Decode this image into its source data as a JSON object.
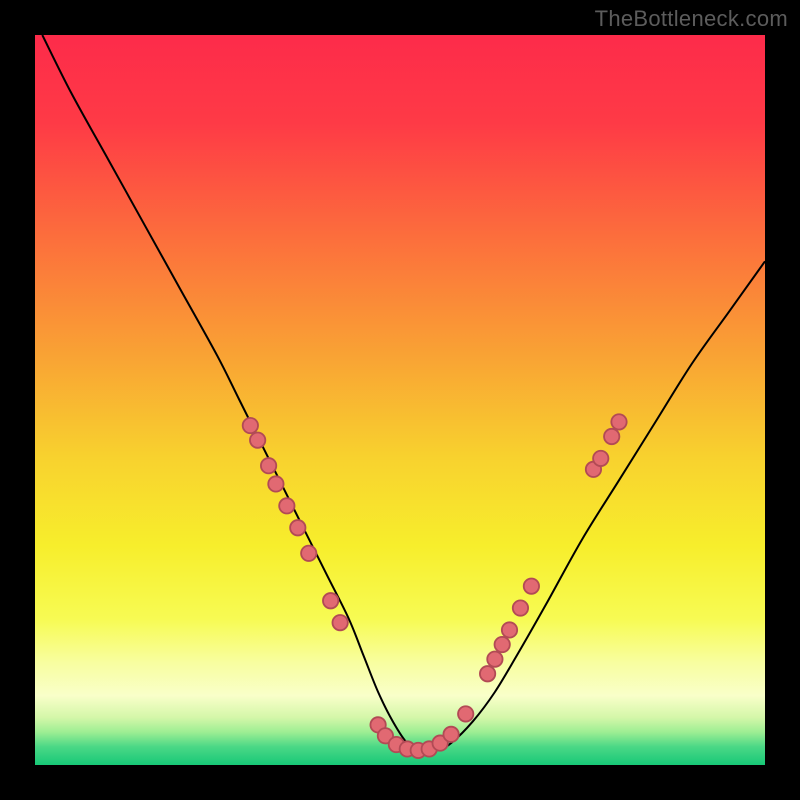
{
  "watermark": "TheBottleneck.com",
  "colors": {
    "bg": "#000000",
    "curve_stroke": "#000000",
    "dot_fill": "#e16972",
    "dot_stroke": "#b24a55",
    "gradient_stops": [
      {
        "offset": 0.0,
        "color": "#fd2b4a"
      },
      {
        "offset": 0.12,
        "color": "#fe3a46"
      },
      {
        "offset": 0.28,
        "color": "#fc6f3c"
      },
      {
        "offset": 0.44,
        "color": "#f9a334"
      },
      {
        "offset": 0.58,
        "color": "#f8d22e"
      },
      {
        "offset": 0.7,
        "color": "#f7ee2c"
      },
      {
        "offset": 0.8,
        "color": "#f7fb53"
      },
      {
        "offset": 0.86,
        "color": "#f8fea0"
      },
      {
        "offset": 0.905,
        "color": "#f9ffc9"
      },
      {
        "offset": 0.935,
        "color": "#d4f7a9"
      },
      {
        "offset": 0.955,
        "color": "#9dee93"
      },
      {
        "offset": 0.975,
        "color": "#4bd886"
      },
      {
        "offset": 1.0,
        "color": "#17c877"
      }
    ]
  },
  "chart_data": {
    "type": "line",
    "title": "",
    "xlabel": "",
    "ylabel": "",
    "xlim": [
      0,
      100
    ],
    "ylim": [
      0,
      100
    ],
    "grid": false,
    "legend": false,
    "series": [
      {
        "name": "bottleneck-curve",
        "x": [
          1,
          5,
          10,
          15,
          20,
          25,
          28,
          31,
          34,
          37,
          40,
          43,
          45,
          47,
          49,
          51,
          53,
          55,
          57,
          60,
          63,
          66,
          70,
          75,
          80,
          85,
          90,
          95,
          100
        ],
        "y": [
          100,
          92,
          83,
          74,
          65,
          56,
          50,
          44,
          38,
          32,
          26,
          20,
          15,
          10,
          6,
          3,
          2,
          2,
          3,
          6,
          10,
          15,
          22,
          31,
          39,
          47,
          55,
          62,
          69
        ]
      }
    ],
    "scatter_overlay": {
      "name": "marker-dots",
      "points": [
        {
          "x": 29.5,
          "y": 46.5
        },
        {
          "x": 30.5,
          "y": 44.5
        },
        {
          "x": 32.0,
          "y": 41.0
        },
        {
          "x": 33.0,
          "y": 38.5
        },
        {
          "x": 34.5,
          "y": 35.5
        },
        {
          "x": 36.0,
          "y": 32.5
        },
        {
          "x": 37.5,
          "y": 29.0
        },
        {
          "x": 40.5,
          "y": 22.5
        },
        {
          "x": 41.8,
          "y": 19.5
        },
        {
          "x": 47.0,
          "y": 5.5
        },
        {
          "x": 48.0,
          "y": 4.0
        },
        {
          "x": 49.5,
          "y": 2.8
        },
        {
          "x": 51.0,
          "y": 2.2
        },
        {
          "x": 52.5,
          "y": 2.0
        },
        {
          "x": 54.0,
          "y": 2.2
        },
        {
          "x": 55.5,
          "y": 3.0
        },
        {
          "x": 57.0,
          "y": 4.2
        },
        {
          "x": 59.0,
          "y": 7.0
        },
        {
          "x": 62.0,
          "y": 12.5
        },
        {
          "x": 63.0,
          "y": 14.5
        },
        {
          "x": 64.0,
          "y": 16.5
        },
        {
          "x": 65.0,
          "y": 18.5
        },
        {
          "x": 66.5,
          "y": 21.5
        },
        {
          "x": 68.0,
          "y": 24.5
        },
        {
          "x": 76.5,
          "y": 40.5
        },
        {
          "x": 77.5,
          "y": 42.0
        },
        {
          "x": 79.0,
          "y": 45.0
        },
        {
          "x": 80.0,
          "y": 47.0
        }
      ]
    }
  }
}
